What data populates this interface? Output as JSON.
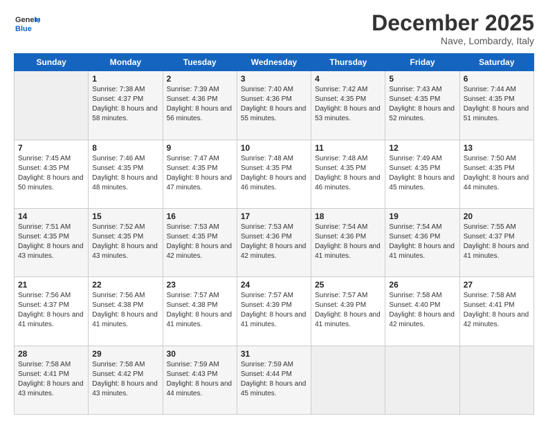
{
  "header": {
    "logo_general": "General",
    "logo_blue": "Blue",
    "month": "December 2025",
    "location": "Nave, Lombardy, Italy"
  },
  "weekdays": [
    "Sunday",
    "Monday",
    "Tuesday",
    "Wednesday",
    "Thursday",
    "Friday",
    "Saturday"
  ],
  "weeks": [
    [
      {
        "day": "",
        "sunrise": "",
        "sunset": "",
        "daylight": ""
      },
      {
        "day": "1",
        "sunrise": "Sunrise: 7:38 AM",
        "sunset": "Sunset: 4:37 PM",
        "daylight": "Daylight: 8 hours and 58 minutes."
      },
      {
        "day": "2",
        "sunrise": "Sunrise: 7:39 AM",
        "sunset": "Sunset: 4:36 PM",
        "daylight": "Daylight: 8 hours and 56 minutes."
      },
      {
        "day": "3",
        "sunrise": "Sunrise: 7:40 AM",
        "sunset": "Sunset: 4:36 PM",
        "daylight": "Daylight: 8 hours and 55 minutes."
      },
      {
        "day": "4",
        "sunrise": "Sunrise: 7:42 AM",
        "sunset": "Sunset: 4:35 PM",
        "daylight": "Daylight: 8 hours and 53 minutes."
      },
      {
        "day": "5",
        "sunrise": "Sunrise: 7:43 AM",
        "sunset": "Sunset: 4:35 PM",
        "daylight": "Daylight: 8 hours and 52 minutes."
      },
      {
        "day": "6",
        "sunrise": "Sunrise: 7:44 AM",
        "sunset": "Sunset: 4:35 PM",
        "daylight": "Daylight: 8 hours and 51 minutes."
      }
    ],
    [
      {
        "day": "7",
        "sunrise": "Sunrise: 7:45 AM",
        "sunset": "Sunset: 4:35 PM",
        "daylight": "Daylight: 8 hours and 50 minutes."
      },
      {
        "day": "8",
        "sunrise": "Sunrise: 7:46 AM",
        "sunset": "Sunset: 4:35 PM",
        "daylight": "Daylight: 8 hours and 48 minutes."
      },
      {
        "day": "9",
        "sunrise": "Sunrise: 7:47 AM",
        "sunset": "Sunset: 4:35 PM",
        "daylight": "Daylight: 8 hours and 47 minutes."
      },
      {
        "day": "10",
        "sunrise": "Sunrise: 7:48 AM",
        "sunset": "Sunset: 4:35 PM",
        "daylight": "Daylight: 8 hours and 46 minutes."
      },
      {
        "day": "11",
        "sunrise": "Sunrise: 7:48 AM",
        "sunset": "Sunset: 4:35 PM",
        "daylight": "Daylight: 8 hours and 46 minutes."
      },
      {
        "day": "12",
        "sunrise": "Sunrise: 7:49 AM",
        "sunset": "Sunset: 4:35 PM",
        "daylight": "Daylight: 8 hours and 45 minutes."
      },
      {
        "day": "13",
        "sunrise": "Sunrise: 7:50 AM",
        "sunset": "Sunset: 4:35 PM",
        "daylight": "Daylight: 8 hours and 44 minutes."
      }
    ],
    [
      {
        "day": "14",
        "sunrise": "Sunrise: 7:51 AM",
        "sunset": "Sunset: 4:35 PM",
        "daylight": "Daylight: 8 hours and 43 minutes."
      },
      {
        "day": "15",
        "sunrise": "Sunrise: 7:52 AM",
        "sunset": "Sunset: 4:35 PM",
        "daylight": "Daylight: 8 hours and 43 minutes."
      },
      {
        "day": "16",
        "sunrise": "Sunrise: 7:53 AM",
        "sunset": "Sunset: 4:35 PM",
        "daylight": "Daylight: 8 hours and 42 minutes."
      },
      {
        "day": "17",
        "sunrise": "Sunrise: 7:53 AM",
        "sunset": "Sunset: 4:36 PM",
        "daylight": "Daylight: 8 hours and 42 minutes."
      },
      {
        "day": "18",
        "sunrise": "Sunrise: 7:54 AM",
        "sunset": "Sunset: 4:36 PM",
        "daylight": "Daylight: 8 hours and 41 minutes."
      },
      {
        "day": "19",
        "sunrise": "Sunrise: 7:54 AM",
        "sunset": "Sunset: 4:36 PM",
        "daylight": "Daylight: 8 hours and 41 minutes."
      },
      {
        "day": "20",
        "sunrise": "Sunrise: 7:55 AM",
        "sunset": "Sunset: 4:37 PM",
        "daylight": "Daylight: 8 hours and 41 minutes."
      }
    ],
    [
      {
        "day": "21",
        "sunrise": "Sunrise: 7:56 AM",
        "sunset": "Sunset: 4:37 PM",
        "daylight": "Daylight: 8 hours and 41 minutes."
      },
      {
        "day": "22",
        "sunrise": "Sunrise: 7:56 AM",
        "sunset": "Sunset: 4:38 PM",
        "daylight": "Daylight: 8 hours and 41 minutes."
      },
      {
        "day": "23",
        "sunrise": "Sunrise: 7:57 AM",
        "sunset": "Sunset: 4:38 PM",
        "daylight": "Daylight: 8 hours and 41 minutes."
      },
      {
        "day": "24",
        "sunrise": "Sunrise: 7:57 AM",
        "sunset": "Sunset: 4:39 PM",
        "daylight": "Daylight: 8 hours and 41 minutes."
      },
      {
        "day": "25",
        "sunrise": "Sunrise: 7:57 AM",
        "sunset": "Sunset: 4:39 PM",
        "daylight": "Daylight: 8 hours and 41 minutes."
      },
      {
        "day": "26",
        "sunrise": "Sunrise: 7:58 AM",
        "sunset": "Sunset: 4:40 PM",
        "daylight": "Daylight: 8 hours and 42 minutes."
      },
      {
        "day": "27",
        "sunrise": "Sunrise: 7:58 AM",
        "sunset": "Sunset: 4:41 PM",
        "daylight": "Daylight: 8 hours and 42 minutes."
      }
    ],
    [
      {
        "day": "28",
        "sunrise": "Sunrise: 7:58 AM",
        "sunset": "Sunset: 4:41 PM",
        "daylight": "Daylight: 8 hours and 43 minutes."
      },
      {
        "day": "29",
        "sunrise": "Sunrise: 7:58 AM",
        "sunset": "Sunset: 4:42 PM",
        "daylight": "Daylight: 8 hours and 43 minutes."
      },
      {
        "day": "30",
        "sunrise": "Sunrise: 7:59 AM",
        "sunset": "Sunset: 4:43 PM",
        "daylight": "Daylight: 8 hours and 44 minutes."
      },
      {
        "day": "31",
        "sunrise": "Sunrise: 7:59 AM",
        "sunset": "Sunset: 4:44 PM",
        "daylight": "Daylight: 8 hours and 45 minutes."
      },
      {
        "day": "",
        "sunrise": "",
        "sunset": "",
        "daylight": ""
      },
      {
        "day": "",
        "sunrise": "",
        "sunset": "",
        "daylight": ""
      },
      {
        "day": "",
        "sunrise": "",
        "sunset": "",
        "daylight": ""
      }
    ]
  ]
}
